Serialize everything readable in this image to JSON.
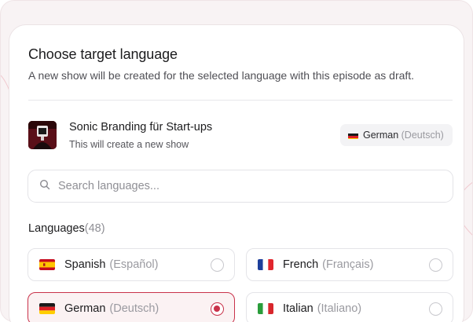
{
  "dialog": {
    "title": "Choose target language",
    "subtitle": "A new show will be created for the selected language with this episode as draft."
  },
  "show": {
    "title": "Sonic Branding für Start-ups",
    "subtitle": "This will create a new show",
    "source_language": {
      "name": "German",
      "native": "(Deutsch)",
      "flag": "de-flag-icon"
    }
  },
  "search": {
    "placeholder": "Search languages...",
    "value": ""
  },
  "languages": {
    "label": "Languages",
    "count": "(48)",
    "options": [
      {
        "name": "Spanish",
        "native": "(Español)",
        "flag": "es-flag-icon",
        "selected": false
      },
      {
        "name": "French",
        "native": "(Français)",
        "flag": "fr-flag-icon",
        "selected": false
      },
      {
        "name": "German",
        "native": "(Deutsch)",
        "flag": "de-flag-icon",
        "selected": true
      },
      {
        "name": "Italian",
        "native": "(Italiano)",
        "flag": "it-flag-icon",
        "selected": false
      }
    ]
  },
  "colors": {
    "accent": "#c9324a",
    "selected_bg": "#fbf2f3"
  }
}
